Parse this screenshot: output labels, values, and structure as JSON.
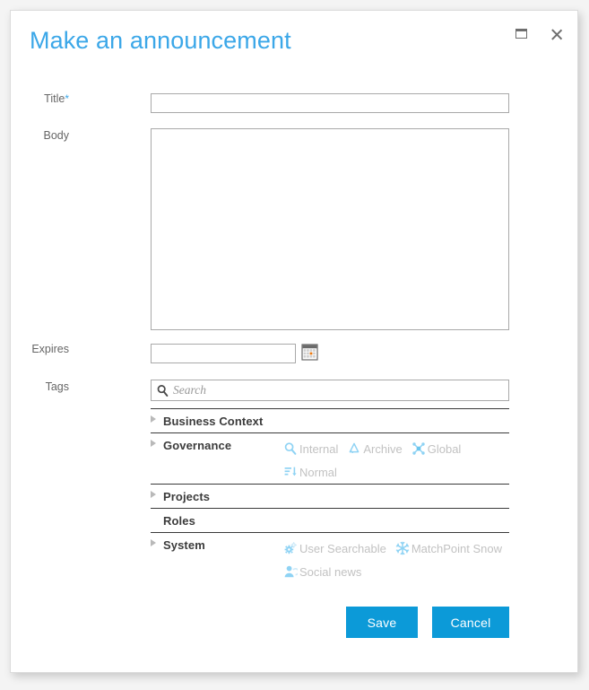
{
  "dialog": {
    "title": "Make an announcement",
    "window_controls": [
      {
        "name": "maximize",
        "label": "Maximize"
      },
      {
        "name": "close",
        "label": "Close"
      }
    ]
  },
  "form": {
    "title_field": {
      "label": "Title",
      "required_marker": "*",
      "value": "",
      "placeholder": ""
    },
    "body_field": {
      "label": "Body",
      "value": "",
      "placeholder": ""
    },
    "expires_field": {
      "label": "Expires",
      "value": "",
      "placeholder": "",
      "calendar_icon": "calendar-icon"
    },
    "tags_field": {
      "label": "Tags",
      "search_value": "",
      "search_placeholder": "Search",
      "search_icon": "search-icon"
    }
  },
  "tag_groups": [
    {
      "name": "Business Context",
      "expandable": true,
      "twisty_icon": "chevron-right-icon",
      "tags": []
    },
    {
      "name": "Governance",
      "expandable": true,
      "twisty_icon": "chevron-right-icon",
      "tags": [
        {
          "label": "Internal",
          "icon": "magnifier-icon"
        },
        {
          "label": "Archive",
          "icon": "recycle-icon"
        },
        {
          "label": "Global",
          "icon": "network-node-icon"
        },
        {
          "label": "Normal",
          "icon": "sort-descending-icon"
        }
      ]
    },
    {
      "name": "Projects",
      "expandable": true,
      "twisty_icon": "chevron-right-icon",
      "tags": []
    },
    {
      "name": "Roles",
      "expandable": false,
      "twisty_icon": "",
      "tags": []
    },
    {
      "name": "System",
      "expandable": true,
      "twisty_icon": "chevron-right-icon",
      "tags": [
        {
          "label": "User Searchable",
          "icon": "gears-icon"
        },
        {
          "label": "MatchPoint Snow",
          "icon": "snowflake-icon"
        },
        {
          "label": "Social news",
          "icon": "user-icon"
        }
      ]
    }
  ],
  "footer": {
    "save_label": "Save",
    "cancel_label": "Cancel"
  },
  "colors": {
    "accent_blue": "#0c9ad8",
    "title_blue": "#3ba7e8",
    "tag_icon_blue": "#8fd3f4",
    "tag_text_gray": "#c2c2c2",
    "label_gray": "#666666",
    "calendar_highlight": "#e8760d"
  }
}
